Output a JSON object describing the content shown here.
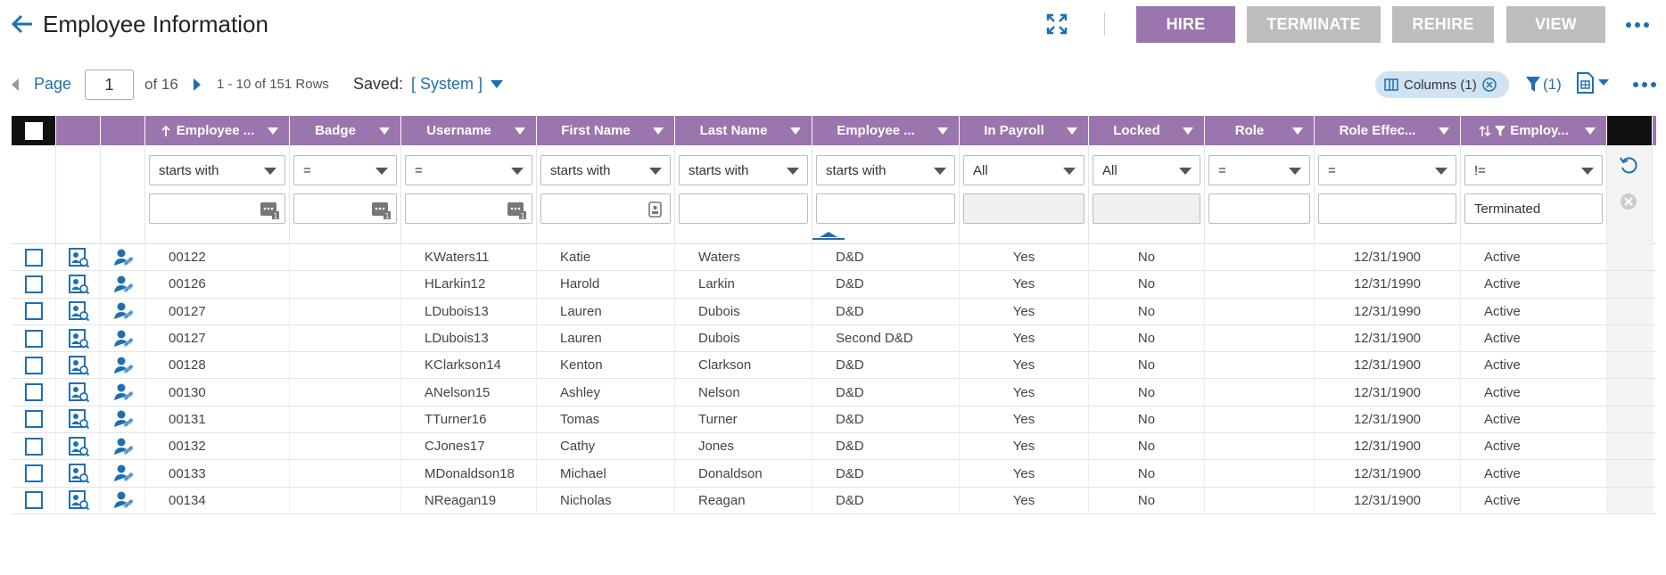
{
  "header": {
    "title": "Employee Information",
    "buttons": {
      "hire": "HIRE",
      "terminate": "TERMINATE",
      "rehire": "REHIRE",
      "view": "VIEW"
    }
  },
  "toolbar": {
    "page_label": "Page",
    "page_value": "1",
    "of_label": "of 16",
    "rows_label": "1 - 10 of 151 Rows",
    "saved_label": "Saved:",
    "saved_value": "[ System ]",
    "columns_label": "Columns (1)",
    "filter_count": "(1)"
  },
  "colors": {
    "accent": "#9b75ad",
    "link": "#1f6fb0",
    "disabled": "#bdbdbd"
  },
  "columns": [
    {
      "key": "employee",
      "label": "Employee ...",
      "sort": "asc"
    },
    {
      "key": "badge",
      "label": "Badge"
    },
    {
      "key": "username",
      "label": "Username"
    },
    {
      "key": "first",
      "label": "First Name"
    },
    {
      "key": "last",
      "label": "Last Name"
    },
    {
      "key": "emp2",
      "label": "Employee ..."
    },
    {
      "key": "payroll",
      "label": "In Payroll"
    },
    {
      "key": "locked",
      "label": "Locked"
    },
    {
      "key": "role",
      "label": "Role"
    },
    {
      "key": "roleeff",
      "label": "Role Effec..."
    },
    {
      "key": "status",
      "label": "Employ...",
      "sort": "both",
      "filtered": true
    }
  ],
  "filters": [
    {
      "op": "starts with",
      "value": ""
    },
    {
      "op": "=",
      "value": ""
    },
    {
      "op": "=",
      "value": ""
    },
    {
      "op": "starts with",
      "value": ""
    },
    {
      "op": "starts with",
      "value": ""
    },
    {
      "op": "starts with",
      "value": ""
    },
    {
      "op": "All",
      "value": ""
    },
    {
      "op": "All",
      "value": ""
    },
    {
      "op": "=",
      "value": ""
    },
    {
      "op": "=",
      "value": ""
    },
    {
      "op": "!=",
      "value": "Terminated"
    }
  ],
  "rows": [
    [
      "00122",
      "",
      "KWaters11",
      "Katie",
      "Waters",
      "D&D",
      "Yes",
      "No",
      "",
      "12/31/1900",
      "Active"
    ],
    [
      "00126",
      "",
      "HLarkin12",
      "Harold",
      "Larkin",
      "D&D",
      "Yes",
      "No",
      "",
      "12/31/1990",
      "Active"
    ],
    [
      "00127",
      "",
      "LDubois13",
      "Lauren",
      "Dubois",
      "D&D",
      "Yes",
      "No",
      "",
      "12/31/1990",
      "Active"
    ],
    [
      "00127",
      "",
      "LDubois13",
      "Lauren",
      "Dubois",
      "Second D&D",
      "Yes",
      "No",
      "",
      "12/31/1900",
      "Active"
    ],
    [
      "00128",
      "",
      "KClarkson14",
      "Kenton",
      "Clarkson",
      "D&D",
      "Yes",
      "No",
      "",
      "12/31/1900",
      "Active"
    ],
    [
      "00130",
      "",
      "ANelson15",
      "Ashley",
      "Nelson",
      "D&D",
      "Yes",
      "No",
      "",
      "12/31/1900",
      "Active"
    ],
    [
      "00131",
      "",
      "TTurner16",
      "Tomas",
      "Turner",
      "D&D",
      "Yes",
      "No",
      "",
      "12/31/1900",
      "Active"
    ],
    [
      "00132",
      "",
      "CJones17",
      "Cathy",
      "Jones",
      "D&D",
      "Yes",
      "No",
      "",
      "12/31/1900",
      "Active"
    ],
    [
      "00133",
      "",
      "MDonaldson18",
      "Michael",
      "Donaldson",
      "D&D",
      "Yes",
      "No",
      "",
      "12/31/1900",
      "Active"
    ],
    [
      "00134",
      "",
      "NReagan19",
      "Nicholas",
      "Reagan",
      "D&D",
      "Yes",
      "No",
      "",
      "12/31/1900",
      "Active"
    ]
  ]
}
